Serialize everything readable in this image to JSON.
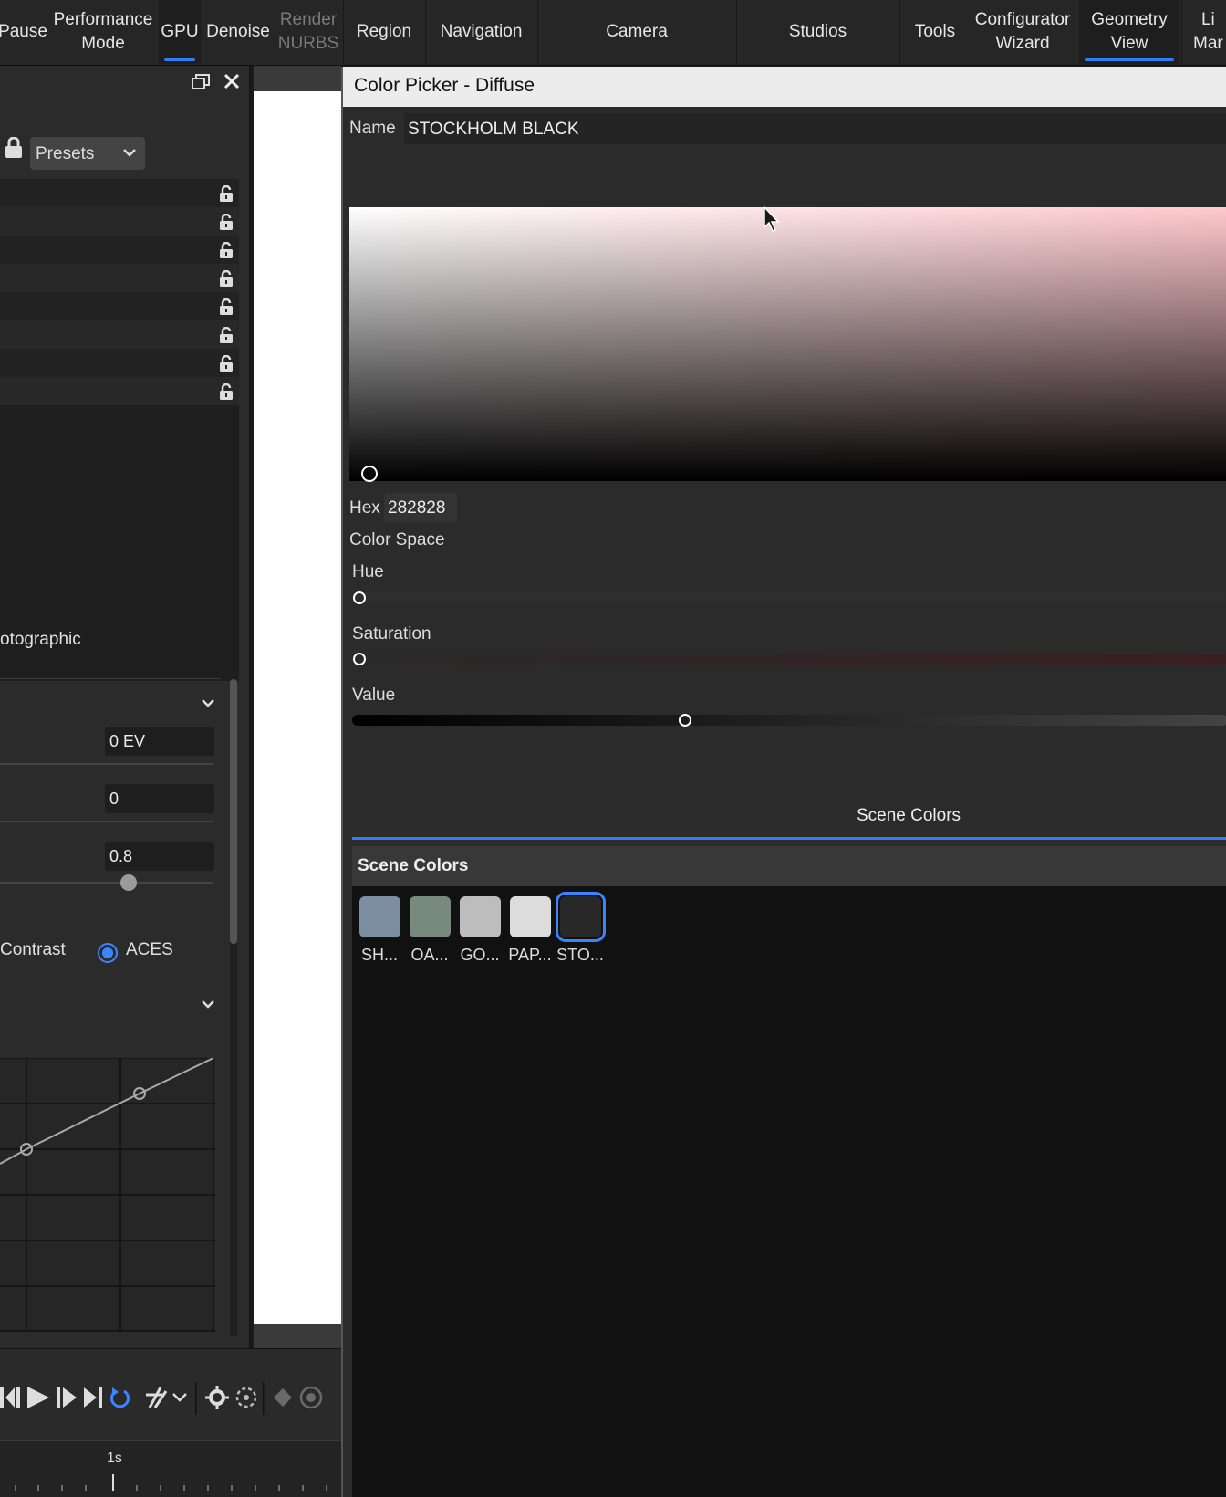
{
  "toolbar": {
    "items": [
      {
        "label": "Pause",
        "disabled": false
      },
      {
        "label": "Performance\nMode",
        "disabled": false
      },
      {
        "label": "GPU",
        "disabled": false,
        "active": true
      },
      {
        "label": "Denoise",
        "disabled": false
      },
      {
        "label": "Render\nNURBS",
        "disabled": true
      },
      {
        "label": "Region",
        "disabled": false
      },
      {
        "label": "Navigation",
        "disabled": false
      },
      {
        "label": "Camera",
        "disabled": false
      },
      {
        "label": "Studios",
        "disabled": false
      },
      {
        "label": "Tools",
        "disabled": false
      },
      {
        "label": "Configurator\nWizard",
        "disabled": false
      },
      {
        "label": "Geometry\nView",
        "disabled": false,
        "active": true
      },
      {
        "label": "Li\nMar",
        "disabled": false
      }
    ]
  },
  "left_panel": {
    "presets_label": "Presets",
    "tonemapping_label": "otographic",
    "exposure_value": "0 EV",
    "param2_value": "0",
    "param3_value": "0.8",
    "radio_contrast_label": "Contrast",
    "radio_aces_label": "ACES"
  },
  "timeline": {
    "time_label": "1s"
  },
  "color_picker": {
    "title": "Color Picker - Diffuse",
    "name_label": "Name",
    "name_value": "STOCKHOLM BLACK",
    "hex_label": "Hex",
    "hex_value": "282828",
    "color_space_label": "Color Space",
    "hue_label": "Hue",
    "saturation_label": "Saturation",
    "value_label": "Value",
    "value_level": 0.38,
    "tab_label": "Scene Colors",
    "scene_colors_header": "Scene Colors",
    "swatches": [
      {
        "label": "SH...",
        "color": "#7b8fa0"
      },
      {
        "label": "OA...",
        "color": "#778a7c"
      },
      {
        "label": "GO...",
        "color": "#bdbdbd"
      },
      {
        "label": "PAP...",
        "color": "#dcdcdc"
      },
      {
        "label": "STO...",
        "color": "#282828",
        "selected": true
      }
    ]
  },
  "colors": {
    "accent": "#2f7cf6",
    "selected_color": "#282828"
  }
}
